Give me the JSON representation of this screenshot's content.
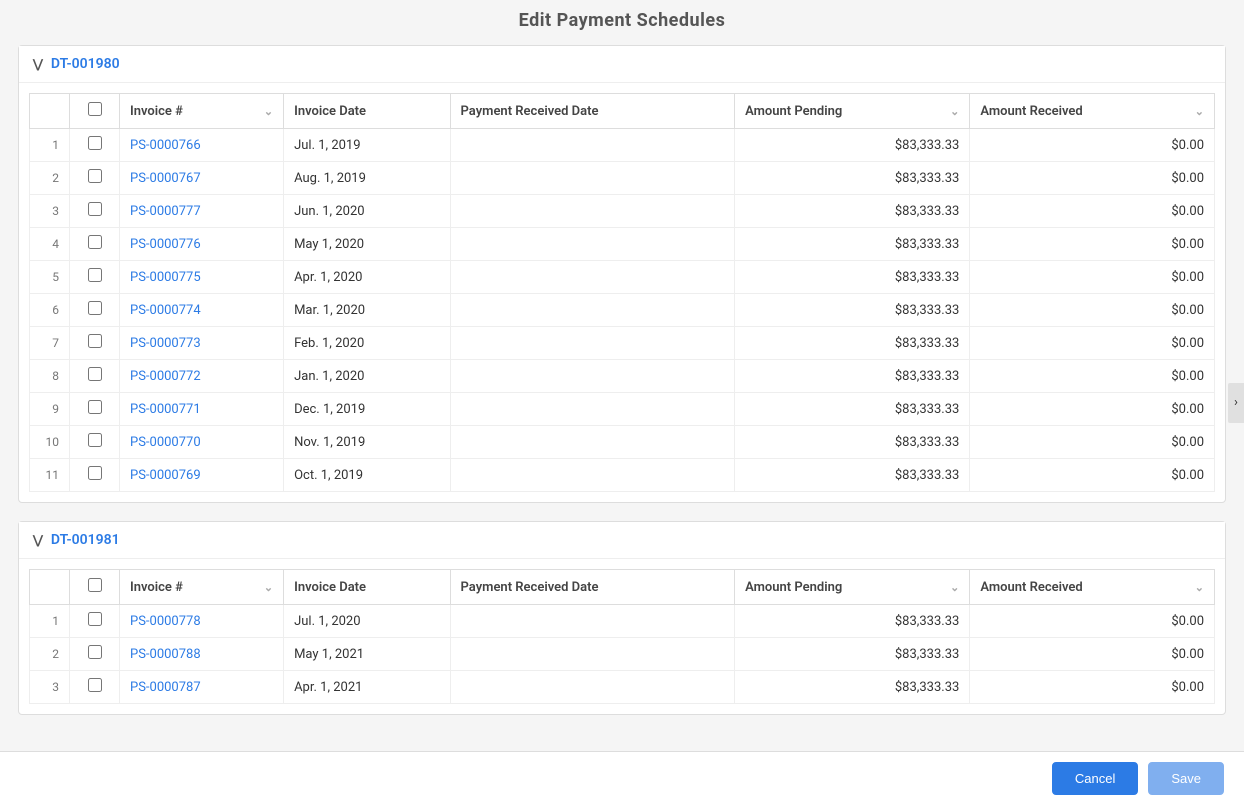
{
  "page": {
    "title": "Edit Payment Schedules",
    "cancel_label": "Cancel",
    "save_label": "Save"
  },
  "sections": [
    {
      "id": "dt-001980",
      "label": "DT-001980",
      "columns": {
        "invoice": "Invoice #",
        "invoice_date": "Invoice Date",
        "payment_received_date": "Payment Received Date",
        "amount_pending": "Amount Pending",
        "amount_received": "Amount Received"
      },
      "rows": [
        {
          "num": 1,
          "invoice": "PS-0000766",
          "invoice_date": "Jul. 1, 2019",
          "payment_received_date": "",
          "amount_pending": "$83,333.33",
          "amount_received": "$0.00"
        },
        {
          "num": 2,
          "invoice": "PS-0000767",
          "invoice_date": "Aug. 1, 2019",
          "payment_received_date": "",
          "amount_pending": "$83,333.33",
          "amount_received": "$0.00"
        },
        {
          "num": 3,
          "invoice": "PS-0000777",
          "invoice_date": "Jun. 1, 2020",
          "payment_received_date": "",
          "amount_pending": "$83,333.33",
          "amount_received": "$0.00"
        },
        {
          "num": 4,
          "invoice": "PS-0000776",
          "invoice_date": "May 1, 2020",
          "payment_received_date": "",
          "amount_pending": "$83,333.33",
          "amount_received": "$0.00"
        },
        {
          "num": 5,
          "invoice": "PS-0000775",
          "invoice_date": "Apr. 1, 2020",
          "payment_received_date": "",
          "amount_pending": "$83,333.33",
          "amount_received": "$0.00"
        },
        {
          "num": 6,
          "invoice": "PS-0000774",
          "invoice_date": "Mar. 1, 2020",
          "payment_received_date": "",
          "amount_pending": "$83,333.33",
          "amount_received": "$0.00"
        },
        {
          "num": 7,
          "invoice": "PS-0000773",
          "invoice_date": "Feb. 1, 2020",
          "payment_received_date": "",
          "amount_pending": "$83,333.33",
          "amount_received": "$0.00"
        },
        {
          "num": 8,
          "invoice": "PS-0000772",
          "invoice_date": "Jan. 1, 2020",
          "payment_received_date": "",
          "amount_pending": "$83,333.33",
          "amount_received": "$0.00"
        },
        {
          "num": 9,
          "invoice": "PS-0000771",
          "invoice_date": "Dec. 1, 2019",
          "payment_received_date": "",
          "amount_pending": "$83,333.33",
          "amount_received": "$0.00"
        },
        {
          "num": 10,
          "invoice": "PS-0000770",
          "invoice_date": "Nov. 1, 2019",
          "payment_received_date": "",
          "amount_pending": "$83,333.33",
          "amount_received": "$0.00"
        },
        {
          "num": 11,
          "invoice": "PS-0000769",
          "invoice_date": "Oct. 1, 2019",
          "payment_received_date": "",
          "amount_pending": "$83,333.33",
          "amount_received": "$0.00"
        }
      ]
    },
    {
      "id": "dt-001981",
      "label": "DT-001981",
      "columns": {
        "invoice": "Invoice #",
        "invoice_date": "Invoice Date",
        "payment_received_date": "Payment Received Date",
        "amount_pending": "Amount Pending",
        "amount_received": "Amount Received"
      },
      "rows": [
        {
          "num": 1,
          "invoice": "PS-0000778",
          "invoice_date": "Jul. 1, 2020",
          "payment_received_date": "",
          "amount_pending": "$83,333.33",
          "amount_received": "$0.00"
        },
        {
          "num": 2,
          "invoice": "PS-0000788",
          "invoice_date": "May 1, 2021",
          "payment_received_date": "",
          "amount_pending": "$83,333.33",
          "amount_received": "$0.00"
        },
        {
          "num": 3,
          "invoice": "PS-0000787",
          "invoice_date": "Apr. 1, 2021",
          "payment_received_date": "",
          "amount_pending": "$83,333.33",
          "amount_received": "$0.00"
        }
      ]
    }
  ]
}
